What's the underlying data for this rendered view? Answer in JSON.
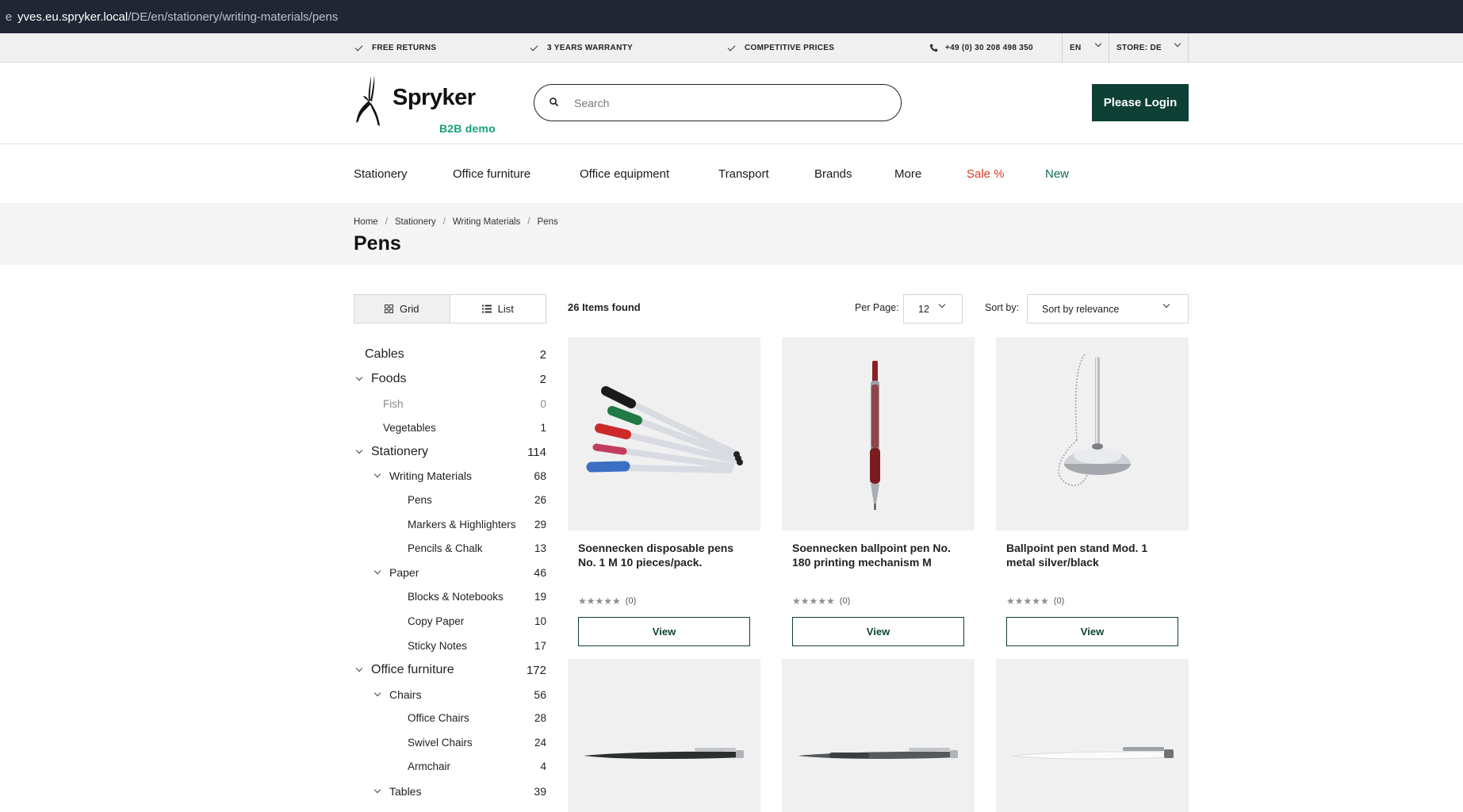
{
  "browser": {
    "url_host": "yves.eu.spryker.local",
    "url_path": "/DE/en/stationery/writing-materials/pens"
  },
  "infobar": {
    "usps": [
      "FREE RETURNS",
      "3 YEARS WARRANTY",
      "COMPETITIVE PRICES"
    ],
    "phone": "+49 (0) 30 208 498 350",
    "language": "EN",
    "store": "STORE: DE"
  },
  "header": {
    "logo_name": "Spryker",
    "logo_sub": "B2B demo",
    "search_placeholder": "Search",
    "login_label": "Please Login"
  },
  "nav": {
    "items": [
      "Stationery",
      "Office furniture",
      "Office equipment",
      "Transport",
      "Brands",
      "More",
      "Sale %",
      "New"
    ]
  },
  "breadcrumb": [
    "Home",
    "Stationery",
    "Writing Materials",
    "Pens"
  ],
  "page_title": "Pens",
  "toolbar": {
    "grid_label": "Grid",
    "list_label": "List",
    "items_found": "26 Items found",
    "per_page_label": "Per Page:",
    "per_page_value": "12",
    "sort_label": "Sort by:",
    "sort_value": "Sort by relevance"
  },
  "categories": [
    {
      "label": "Cables",
      "count": "2"
    },
    {
      "label": "Foods",
      "count": "2"
    },
    {
      "label": "Fish",
      "count": "0"
    },
    {
      "label": "Vegetables",
      "count": "1"
    },
    {
      "label": "Stationery",
      "count": "114"
    },
    {
      "label": "Writing Materials",
      "count": "68"
    },
    {
      "label": "Pens",
      "count": "26"
    },
    {
      "label": "Markers & Highlighters",
      "count": "29"
    },
    {
      "label": "Pencils & Chalk",
      "count": "13"
    },
    {
      "label": "Paper",
      "count": "46"
    },
    {
      "label": "Blocks & Notebooks",
      "count": "19"
    },
    {
      "label": "Copy Paper",
      "count": "10"
    },
    {
      "label": "Sticky Notes",
      "count": "17"
    },
    {
      "label": "Office furniture",
      "count": "172"
    },
    {
      "label": "Chairs",
      "count": "56"
    },
    {
      "label": "Office Chairs",
      "count": "28"
    },
    {
      "label": "Swivel Chairs",
      "count": "24"
    },
    {
      "label": "Armchair",
      "count": "4"
    },
    {
      "label": "Tables",
      "count": "39"
    }
  ],
  "products": [
    {
      "title": "Soennecken disposable pens No. 1 M 10 pieces/pack.",
      "stars": "★★★★★",
      "reviews": "(0)",
      "view_label": "View"
    },
    {
      "title": "Soennecken ballpoint pen No. 180 printing mechanism M",
      "stars": "★★★★★",
      "reviews": "(0)",
      "view_label": "View"
    },
    {
      "title": "Ballpoint pen stand Mod. 1 metal silver/black",
      "stars": "★★★★★",
      "reviews": "(0)",
      "view_label": "View"
    }
  ]
}
